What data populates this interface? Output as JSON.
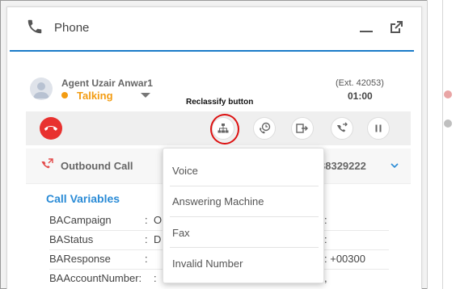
{
  "panel": {
    "title": "Phone"
  },
  "agent": {
    "name": "Agent Uzair Anwar1",
    "status": "Talking",
    "extension": "(Ext. 42053)",
    "timer": "01:00"
  },
  "annotation": {
    "reclassify_label": "Reclassify button"
  },
  "call": {
    "title": "Outbound Call",
    "number_partial": "38329222"
  },
  "call_variables": {
    "title": "Call Variables",
    "rows": [
      {
        "label": "BACampaign",
        "colon": ":",
        "left_value": "O",
        "right_value": ":"
      },
      {
        "label": "BAStatus",
        "colon": ":",
        "left_value": "D",
        "right_value": ":"
      },
      {
        "label": "BAResponse",
        "colon": ":",
        "left_value": "",
        "right_value": ": +00300"
      },
      {
        "label": "BAAccountNumber:",
        "colon": "",
        "left_value": ":",
        "right_value": ","
      }
    ]
  },
  "reclassify_menu": {
    "items": [
      "Voice",
      "Answering Machine",
      "Fax",
      "Invalid Number"
    ]
  },
  "colors": {
    "accent_blue": "#1a7bc8",
    "status_orange": "#f39c12",
    "hangup_red": "#e8312f",
    "annotation_red": "#dd1111"
  }
}
